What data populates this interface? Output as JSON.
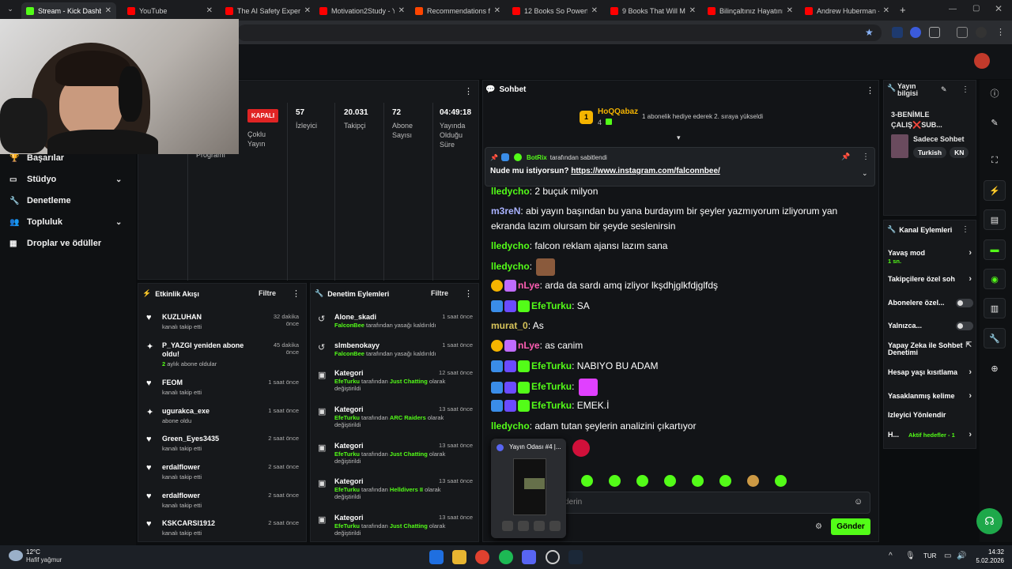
{
  "tabs": [
    {
      "label": "Stream - Kick Dashbo",
      "color": "#53fc18"
    },
    {
      "label": "YouTube",
      "color": "#ff0000"
    },
    {
      "label": "The AI Safety Expert:",
      "color": "#ff0000"
    },
    {
      "label": "Motivation2Study - Y",
      "color": "#ff0000"
    },
    {
      "label": "Recommendations fo",
      "color": "#ff4500"
    },
    {
      "label": "12 Books So Powerfu",
      "color": "#ff0000"
    },
    {
      "label": "9 Books That Will Ma",
      "color": "#ff0000"
    },
    {
      "label": "Bilinçaltınız Hayatınız",
      "color": "#ff0000"
    },
    {
      "label": "Andrew Huberman -",
      "color": "#ff0000"
    }
  ],
  "leftnav": {
    "items": [
      {
        "label": "Başarılar",
        "icon": "trophy-icon"
      },
      {
        "label": "Stüdyo",
        "icon": "monitor-icon",
        "chev": "⌄"
      },
      {
        "label": "Denetleme",
        "icon": "wrench-icon"
      },
      {
        "label": "Topluluk",
        "icon": "users-icon",
        "chev": "⌄"
      },
      {
        "label": "Droplar ve ödüller",
        "icon": "drops-icon"
      }
    ]
  },
  "stats": {
    "partial_label": "Programı",
    "status": "KAPALI",
    "status_sub": "Çoklu\nYayın",
    "viewers": {
      "value": "57",
      "label": "İzleyici"
    },
    "followers": {
      "value": "20.031",
      "label": "Takipçi"
    },
    "subs": {
      "value": "72",
      "label": "Abone Sayısı"
    },
    "uptime": {
      "value": "04:49:18",
      "label": "Yayında Olduğu Süre"
    }
  },
  "activity": {
    "title": "Etkinlik Akışı",
    "filter": "Filtre",
    "items": [
      {
        "name": "KUZLUHAN",
        "sub": "kanalı takip etti",
        "time": "32 dakika önce",
        "icon": "♥"
      },
      {
        "name": "P_YAZGI yeniden abone oldu!",
        "sub": "2 aylık abone oldular",
        "sub_g": "2",
        "time": "45 dakika önce",
        "icon": "✦"
      },
      {
        "name": "FEOM",
        "sub": "kanalı takip etti",
        "time": "1 saat önce",
        "icon": "♥"
      },
      {
        "name": "ugurakca_exe",
        "sub": "abone oldu",
        "time": "1 saat önce",
        "icon": "✦"
      },
      {
        "name": "Green_Eyes3435",
        "sub": "kanalı takip etti",
        "time": "2 saat önce",
        "icon": "♥"
      },
      {
        "name": "erdalflower",
        "sub": "kanalı takip etti",
        "time": "2 saat önce",
        "icon": "♥"
      },
      {
        "name": "erdalflower",
        "sub": "kanalı takip etti",
        "time": "2 saat önce",
        "icon": "♥"
      },
      {
        "name": "KSKCARSI1912",
        "sub": "kanalı takip etti",
        "time": "2 saat önce",
        "icon": "♥"
      }
    ]
  },
  "modlog": {
    "title": "Denetim Eylemleri",
    "filter": "Filtre",
    "items": [
      {
        "name": "Alone_skadi",
        "by": "FalconBee",
        "text": " tarafından yasağı kaldırıldı",
        "time": "1 saat önce",
        "icon": "↺"
      },
      {
        "name": "slmbenokayy",
        "by": "FalconBee",
        "text": " tarafından yasağı kaldırıldı",
        "time": "1 saat önce",
        "icon": "↺"
      },
      {
        "name": "Kategori",
        "by": "EfeTurku",
        "text": " tarafından ",
        "cat": "Just Chatting",
        "text2": " olarak değiştirildi",
        "time": "12 saat önce",
        "icon": "▣"
      },
      {
        "name": "Kategori",
        "by": "EfeTurku",
        "text": " tarafından ",
        "cat": "ARC Raiders",
        "text2": " olarak değiştirildi",
        "time": "13 saat önce",
        "icon": "▣"
      },
      {
        "name": "Kategori",
        "by": "EfeTurku",
        "text": " tarafından ",
        "cat": "Just Chatting",
        "text2": " olarak değiştirildi",
        "time": "13 saat önce",
        "icon": "▣"
      },
      {
        "name": "Kategori",
        "by": "EfeTurku",
        "text": " tarafından ",
        "cat": "Helldivers II",
        "text2": " olarak değiştirildi",
        "time": "13 saat önce",
        "icon": "▣"
      },
      {
        "name": "Kategori",
        "by": "EfeTurku",
        "text": " tarafından ",
        "cat": "Just Chatting",
        "text2": " olarak değiştirildi",
        "time": "13 saat önce",
        "icon": "▣"
      }
    ]
  },
  "chat": {
    "title": "Sohbet",
    "gift_user": "HoQQabaz",
    "gift_count": "4",
    "gift_text": "1 abonelik hediye ederek 2. sıraya yükseldi",
    "pinned_by": "BotRix",
    "pinned_suffix": " tarafından sabitlendi",
    "pinned_msg": "Nude mu istiyorsun? ",
    "pinned_link": "https://www.instagram.com/falconnbee/",
    "messages": [
      {
        "user": "lledycho",
        "color": "#53fc18",
        "text": " 2 buçuk milyon",
        "badges": []
      },
      {
        "user": "m3reN",
        "color": "#a9b2ff",
        "text": " abi yayın başından bu yana burdayım bir şeyler yazmıyorum izliyorum yan ekranda lazım olursam bir şeyde seslenirsin",
        "badges": []
      },
      {
        "user": "lledycho",
        "color": "#53fc18",
        "text": " falcon reklam ajansı lazım sana",
        "badges": []
      },
      {
        "user": "lledycho",
        "color": "#53fc18",
        "text": " ",
        "badges": [],
        "emote": true
      },
      {
        "user": "nLye",
        "color": "#ff5eb3",
        "text": " arda da sardı amq izliyor lkşdhjglkfdjglfdş",
        "badges": [
          "#f5b400",
          "#c06bff"
        ]
      },
      {
        "user": "EfeTurku",
        "color": "#53fc18",
        "text": " SA",
        "badges": [
          "#3a8de8",
          "#6b4bff",
          "#53fc18"
        ]
      },
      {
        "user": "murat_0",
        "color": "#d7c35a",
        "text": " As",
        "badges": []
      },
      {
        "user": "nLye",
        "color": "#ff5eb3",
        "text": " as canim",
        "badges": [
          "#f5b400",
          "#c06bff"
        ]
      },
      {
        "user": "EfeTurku",
        "color": "#53fc18",
        "text": " NABIYO BU ADAM",
        "badges": [
          "#3a8de8",
          "#6b4bff",
          "#53fc18"
        ]
      },
      {
        "user": "EfeTurku",
        "color": "#53fc18",
        "text": " ",
        "badges": [
          "#3a8de8",
          "#6b4bff",
          "#53fc18"
        ],
        "emote": true
      },
      {
        "user": "EfeTurku",
        "color": "#53fc18",
        "text": " EMEK.İ",
        "badges": [
          "#3a8de8",
          "#6b4bff",
          "#53fc18"
        ]
      },
      {
        "user": "lledycho",
        "color": "#53fc18",
        "text": " adam tutan şeylerin analizini çıkartıyor",
        "badges": []
      }
    ],
    "input_placeholder": "derin",
    "send": "Gönder"
  },
  "popup": {
    "title": "Yayın Odası #4 |..."
  },
  "streaminfo": {
    "title": "Yayın bilgisi",
    "stream_title": "3-BENİMLE ÇALIŞ❌SUB...",
    "category": "Sadece Sohbet",
    "tags": [
      "Turkish",
      "KN"
    ]
  },
  "channel_actions": {
    "title": "Kanal Eylemleri",
    "items": [
      {
        "label": "Yavaş mod",
        "sub": "1 sn.",
        "ctl": "chev"
      },
      {
        "label": "Takipçilere özel soh",
        "ctl": "chev"
      },
      {
        "label": "Abonelere özel...",
        "ctl": "toggle"
      },
      {
        "label": "Yalnızca...",
        "ctl": "toggle"
      },
      {
        "label": "Yapay Zeka ile Sohbet Denetimi",
        "ctl": "ext"
      },
      {
        "label": "Hesap yaşı kısıtlama",
        "ctl": "chev"
      },
      {
        "label": "Yasaklanmış kelime",
        "ctl": "chev"
      },
      {
        "label": "İzleyici Yönlendir",
        "ctl": "none"
      },
      {
        "label": "H...",
        "sub": "Aktif hedefler - 1",
        "ctl": "chev"
      }
    ]
  },
  "taskbar": {
    "weather_temp": "12°C",
    "weather_desc": "Hafif yağmur",
    "lang": "TUR",
    "time": "14:32",
    "date": "5.02.2026"
  },
  "colors": {
    "accent": "#53fc18",
    "bg": "#0b0d0f",
    "panel": "#16181b",
    "status_red": "#e02424"
  }
}
